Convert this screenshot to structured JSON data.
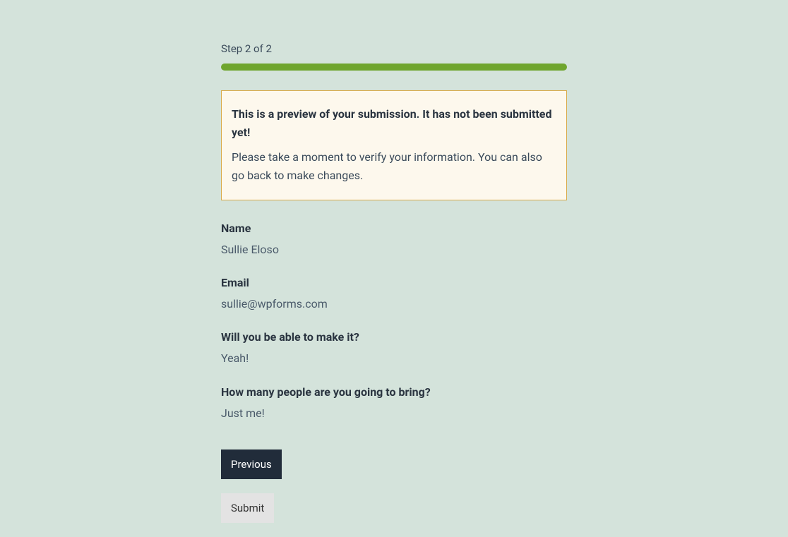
{
  "step": {
    "label": "Step 2 of 2"
  },
  "notice": {
    "title": "This is a preview of your submission. It has not been submitted yet!",
    "text": "Please take a moment to verify your information. You can also go back to make changes."
  },
  "fields": {
    "name": {
      "label": "Name",
      "value": "Sullie Eloso"
    },
    "email": {
      "label": "Email",
      "value": "sullie@wpforms.com"
    },
    "attendance": {
      "label": "Will you be able to make it?",
      "value": "Yeah!"
    },
    "guests": {
      "label": "How many people are you going to bring?",
      "value": "Just me!"
    }
  },
  "buttons": {
    "previous": "Previous",
    "submit": "Submit"
  }
}
